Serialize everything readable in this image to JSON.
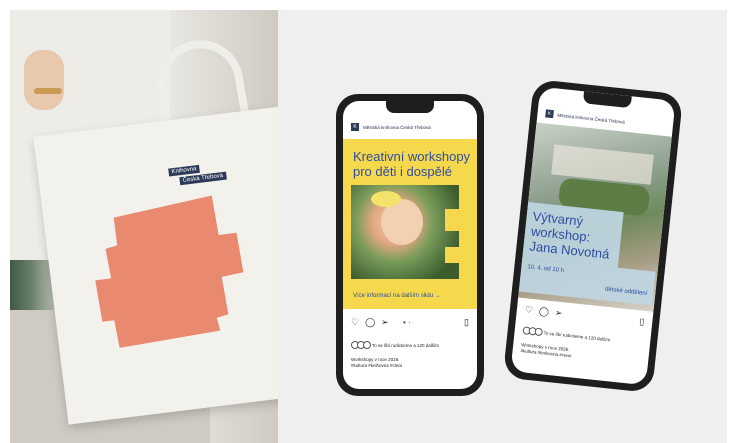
{
  "tote": {
    "label_line1": "Knihovna",
    "label_line2": "Česká Třebová"
  },
  "colors": {
    "accent_blue": "#2e4da0",
    "accent_yellow": "#f6d84c",
    "tote_shape": "#e98a70",
    "light_blue": "#bfd6e2"
  },
  "post1": {
    "account": "Městská knihovna Česká Třebová",
    "title": "Kreativní workshopy pro děti i dospělé",
    "link": "Více informací na dalším slidu →",
    "likes": "To se líbí rudictieme a 120 dalším",
    "caption_line1": "Workshopy v roce 2026.",
    "caption_line2": "#kultura #knihovna #cteni"
  },
  "post2": {
    "account": "Městská knihovna Česká Třebová",
    "title": "Výtvarný workshop: Jana Novotná",
    "date": "10. 4. od 10 h",
    "location": "dětské oddělení",
    "likes": "To se líbí rudictieme a 120 dalším",
    "caption_line1": "Workshopy v roce 2026.",
    "caption_line2": "#kultura #knihovna #cteni"
  },
  "icons": {
    "heart": "♡",
    "comment": "◯",
    "share": "➢",
    "bookmark": "▯",
    "dots": "• ·"
  }
}
